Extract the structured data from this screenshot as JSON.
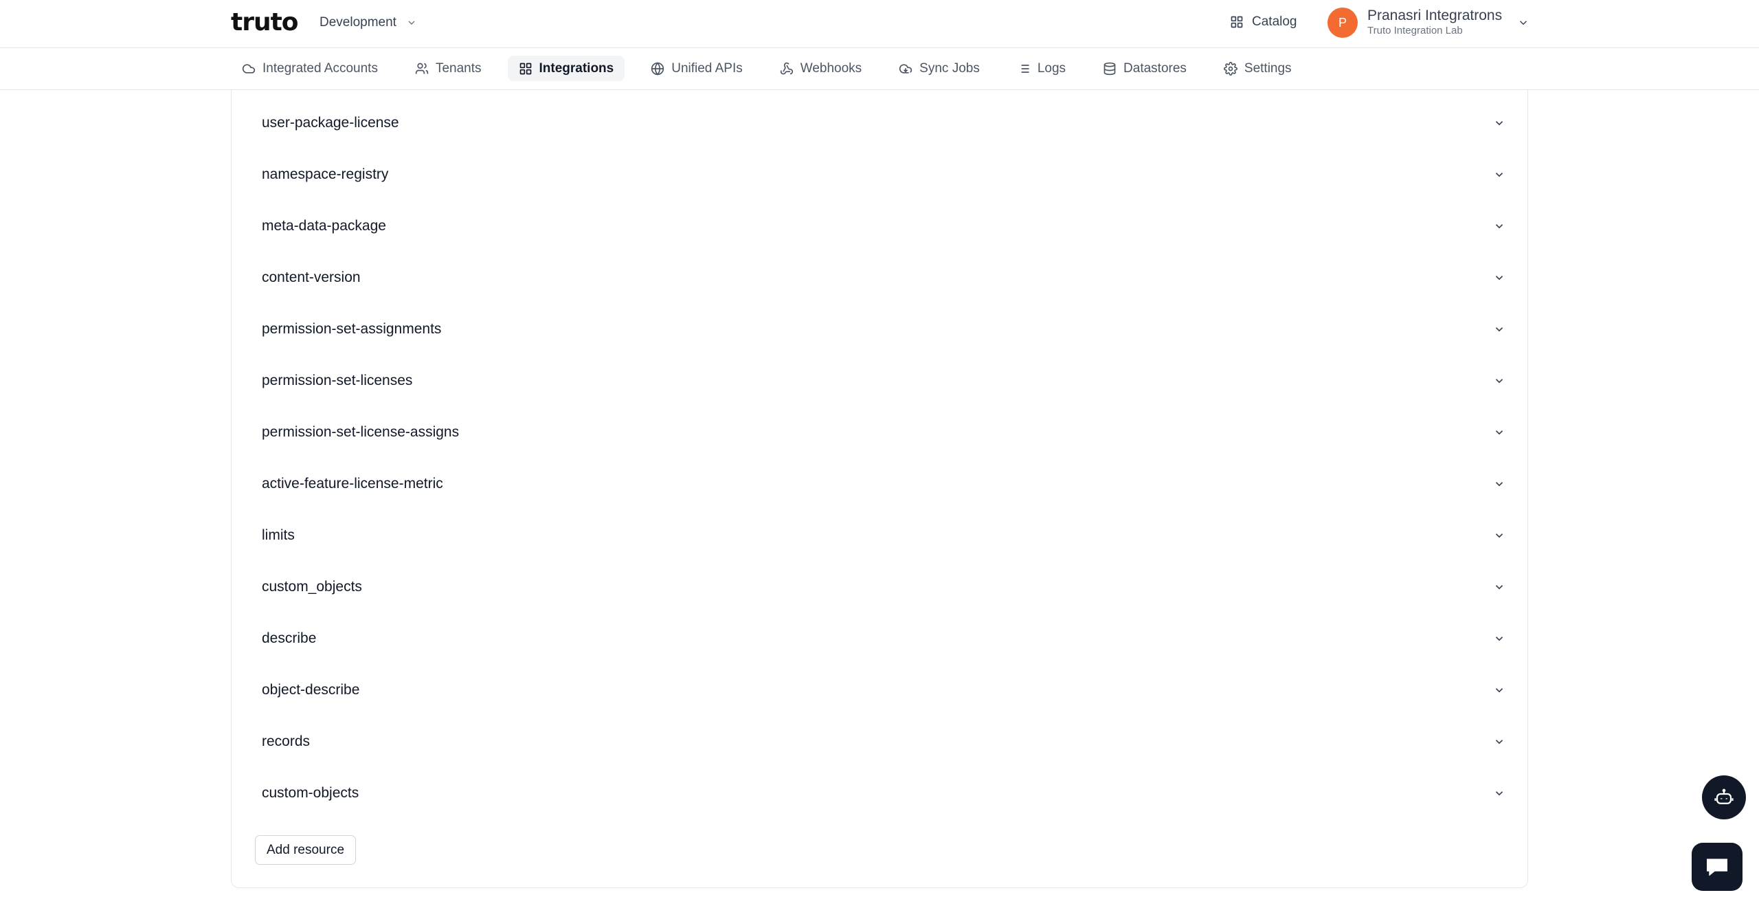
{
  "header": {
    "logo_text": "truto",
    "environment": "Development",
    "catalog_label": "Catalog",
    "user": {
      "initial": "P",
      "name": "Pranasri Integratrons",
      "org": "Truto Integration Lab",
      "avatar_color": "#f46b32"
    }
  },
  "nav": {
    "items": [
      {
        "label": "Integrated Accounts",
        "icon": "cloud-icon"
      },
      {
        "label": "Tenants",
        "icon": "users-icon"
      },
      {
        "label": "Integrations",
        "icon": "grid-icon",
        "active": true
      },
      {
        "label": "Unified APIs",
        "icon": "globe-icon"
      },
      {
        "label": "Webhooks",
        "icon": "webhook-icon"
      },
      {
        "label": "Sync Jobs",
        "icon": "sync-icon"
      },
      {
        "label": "Logs",
        "icon": "list-icon"
      },
      {
        "label": "Datastores",
        "icon": "database-icon"
      },
      {
        "label": "Settings",
        "icon": "gear-icon"
      }
    ]
  },
  "resources": [
    "user-package-license",
    "namespace-registry",
    "meta-data-package",
    "content-version",
    "permission-set-assignments",
    "permission-set-licenses",
    "permission-set-license-assigns",
    "active-feature-license-metric",
    "limits",
    "custom_objects",
    "describe",
    "object-describe",
    "records",
    "custom-objects"
  ],
  "add_resource_label": "Add resource"
}
